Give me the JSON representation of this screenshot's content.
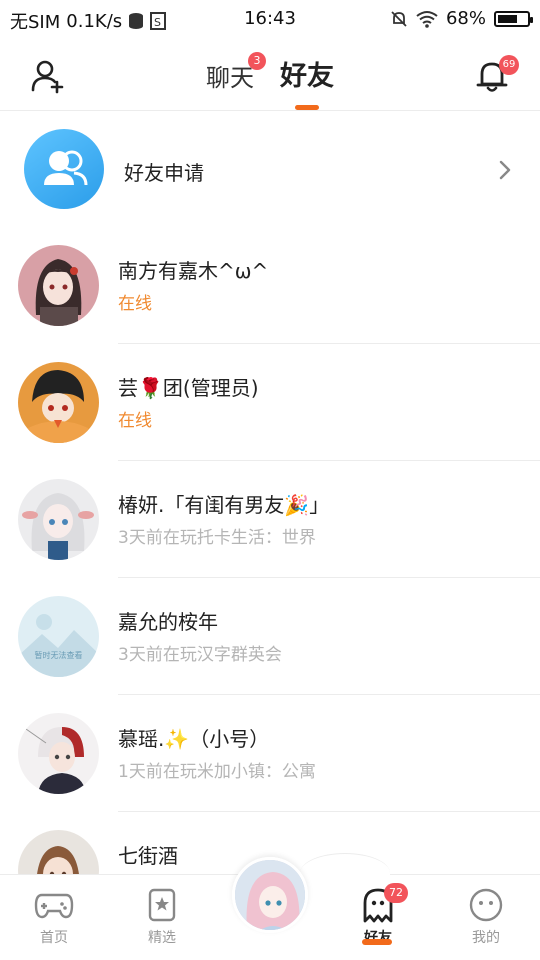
{
  "status_bar": {
    "carrier": "无SIM",
    "speed": "0.1K/s",
    "time": "16:43",
    "battery": "68%",
    "battery_level": 0.68
  },
  "header": {
    "tabs": [
      {
        "label": "聊天",
        "badge": "3",
        "active": false
      },
      {
        "label": "好友",
        "badge": "",
        "active": true
      }
    ],
    "bell_badge": "69",
    "accent": "#f26a1b"
  },
  "friend_request": {
    "label": "好友申请"
  },
  "friends": [
    {
      "name": "南方有嘉木^ω^",
      "status": "在线",
      "online": true,
      "avatar_color": "#c7828b"
    },
    {
      "name": "芸🌹团(管理员)",
      "status": "在线",
      "online": true,
      "avatar_color": "#e79a3f"
    },
    {
      "name": "椿妍.「有闺有男友🎉」",
      "status": "3天前在玩托卡生活：世界",
      "online": false,
      "avatar_color": "#e7e7ea"
    },
    {
      "name": "嘉允的桉年",
      "status": "3天前在玩汉字群英会",
      "online": false,
      "avatar_color": "#cfe6ef",
      "avatar_text": "暂时无法查看"
    },
    {
      "name": "慕瑶.✨（小号）",
      "status": "1天前在玩米加小镇：公寓",
      "online": false,
      "avatar_color": "#c2a9b9"
    },
    {
      "name": "七街酒",
      "status": "",
      "online": false,
      "avatar_color": "#c9a489"
    }
  ],
  "bottom_nav": {
    "items": [
      {
        "label": "首页",
        "icon": "gamepad-icon"
      },
      {
        "label": "精选",
        "icon": "star-bookmark-icon"
      },
      {
        "label": "好友",
        "icon": "ghost-icon",
        "badge": "72",
        "active": true
      },
      {
        "label": "我的",
        "icon": "face-icon"
      }
    ]
  }
}
